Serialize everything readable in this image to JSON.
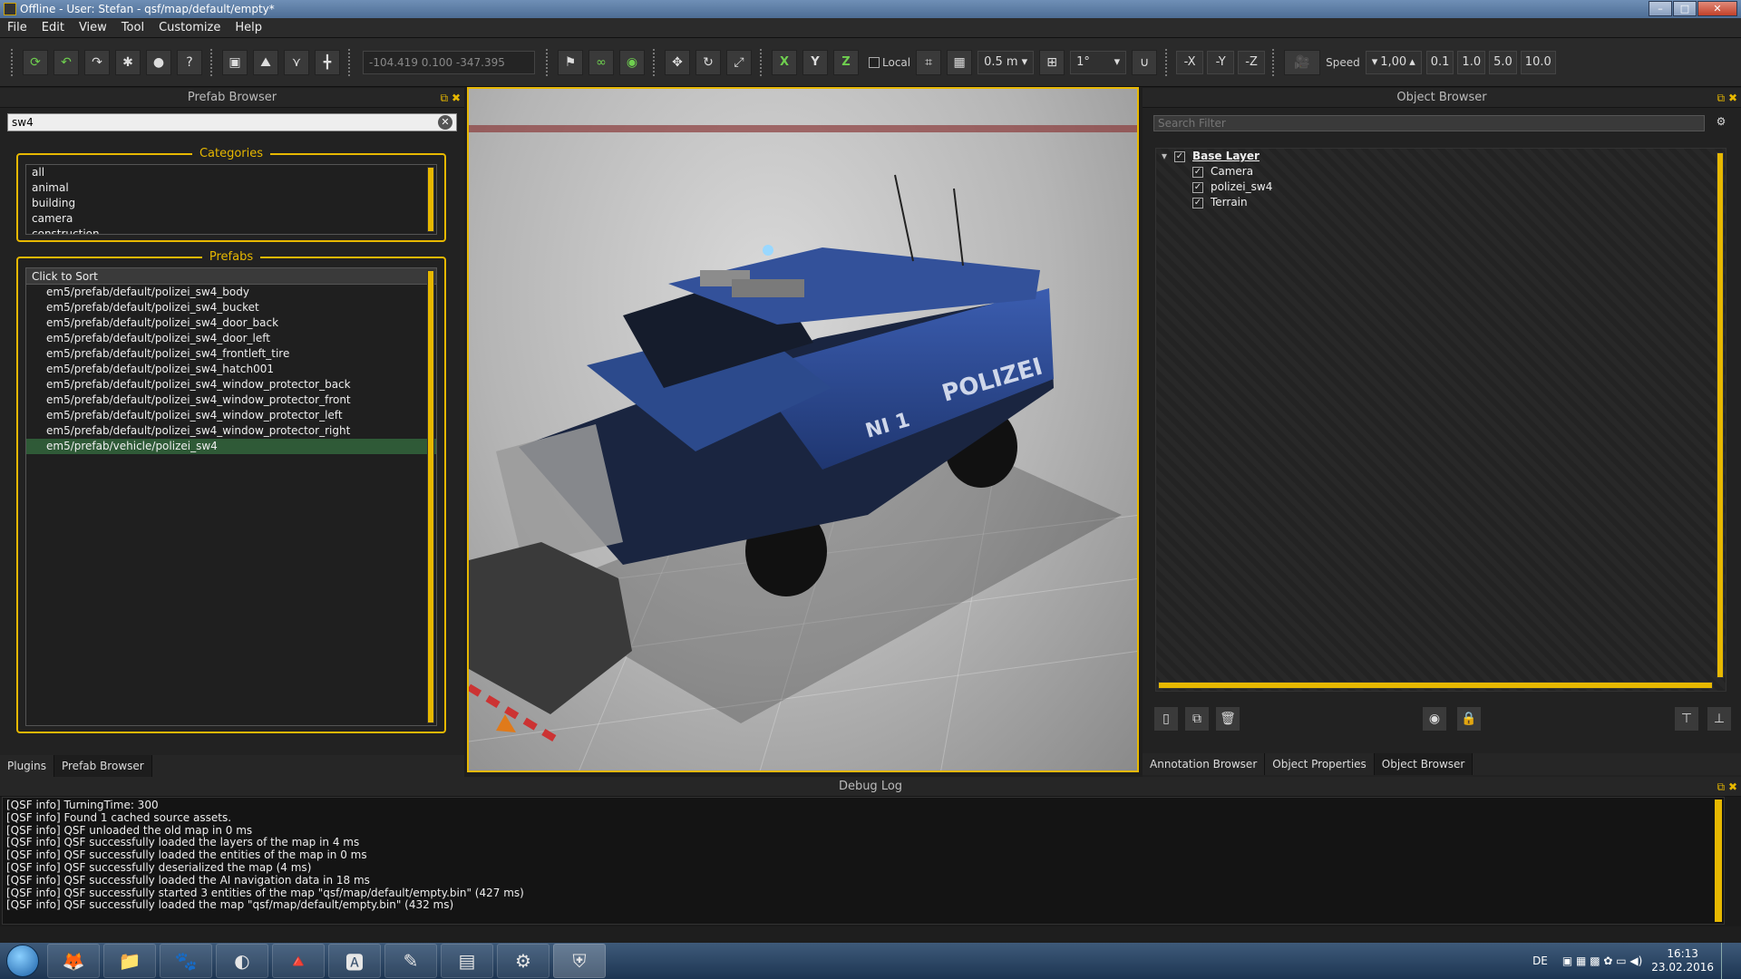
{
  "window": {
    "title": "Offline - User: Stefan - qsf/map/default/empty*"
  },
  "menu": [
    "File",
    "Edit",
    "View",
    "Tool",
    "Customize",
    "Help"
  ],
  "toolbar": {
    "coords": "-104.419 0.100 -347.395",
    "axis_x": "X",
    "axis_y": "Y",
    "axis_z": "Z",
    "local_label": "Local",
    "grid_size": "0.5 m",
    "angle": "1°",
    "neg_x": "-X",
    "neg_y": "-Y",
    "neg_z": "-Z",
    "speed_label": "Speed",
    "speed_value": "1,00",
    "speed_presets": [
      "0.1",
      "1.0",
      "5.0",
      "10.0"
    ]
  },
  "prefab_browser": {
    "title": "Prefab Browser",
    "search_value": "sw4",
    "categories_label": "Categories",
    "categories": [
      "all",
      "animal",
      "building",
      "camera",
      "construction"
    ],
    "prefabs_label": "Prefabs",
    "sort_header": "Click to Sort",
    "prefabs": [
      "em5/prefab/default/polizei_sw4_body",
      "em5/prefab/default/polizei_sw4_bucket",
      "em5/prefab/default/polizei_sw4_door_back",
      "em5/prefab/default/polizei_sw4_door_left",
      "em5/prefab/default/polizei_sw4_frontleft_tire",
      "em5/prefab/default/polizei_sw4_hatch001",
      "em5/prefab/default/polizei_sw4_window_protector_back",
      "em5/prefab/default/polizei_sw4_window_protector_front",
      "em5/prefab/default/polizei_sw4_window_protector_left",
      "em5/prefab/default/polizei_sw4_window_protector_right",
      "em5/prefab/vehicle/polizei_sw4"
    ],
    "tabs": [
      "Plugins",
      "Prefab Browser"
    ]
  },
  "viewport": {
    "vehicle_text": "POLIZEI",
    "plate_text": "NI 1"
  },
  "object_browser": {
    "title": "Object Browser",
    "search_placeholder": "Search Filter",
    "layer": "Base Layer",
    "items": [
      "Camera",
      "polizei_sw4",
      "Terrain"
    ],
    "tabs": [
      "Annotation Browser",
      "Object Properties",
      "Object Browser"
    ]
  },
  "debug_log": {
    "title": "Debug Log",
    "lines": [
      "[QSF info] TurningTime: 300",
      "[QSF info] Found 1 cached source assets.",
      "[QSF info] QSF unloaded the old map in 0 ms",
      "[QSF info] QSF successfully loaded the layers of the map in 4 ms",
      "[QSF info] QSF successfully loaded the entities of the map in 0 ms",
      "[QSF info] QSF successfully deserialized the map (4 ms)",
      "[QSF info] QSF successfully loaded the AI navigation data in 18 ms",
      "[QSF info] QSF successfully started 3 entities of the map \"qsf/map/default/empty.bin\" (427 ms)",
      "[QSF info] QSF successfully loaded the map \"qsf/map/default/empty.bin\" (432 ms)"
    ]
  },
  "taskbar": {
    "lang": "DE",
    "time": "16:13",
    "date": "23.02.2016"
  },
  "colors": {
    "accent": "#e7b800",
    "selection": "#2f5a37",
    "vehicle_blue": "#2c4a8c"
  }
}
